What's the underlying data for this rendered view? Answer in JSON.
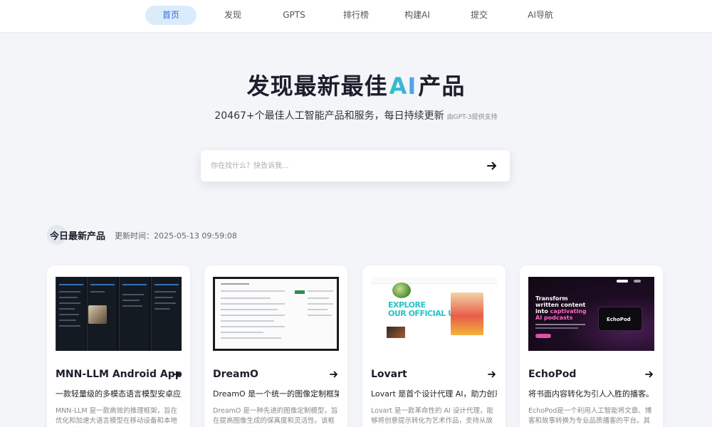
{
  "nav": {
    "items": [
      {
        "label": "首页",
        "active": true
      },
      {
        "label": "发现",
        "active": false
      },
      {
        "label": "GPTS",
        "active": false
      },
      {
        "label": "排行榜",
        "active": false
      },
      {
        "label": "构建AI",
        "active": false
      },
      {
        "label": "提交",
        "active": false
      },
      {
        "label": "AI导航",
        "active": false
      }
    ]
  },
  "hero": {
    "title_prefix": "发现最新最佳",
    "title_ai": "AI",
    "title_suffix": "产品",
    "subtitle": "20467+个最佳人工智能产品和服务，每日持续更新",
    "subtitle_note": "由GPT-3提供支持"
  },
  "search": {
    "placeholder": "你在找什么？快告诉我..."
  },
  "section": {
    "title": "今日最新产品",
    "updated": "更新时间：2025-05-13 09:59:08"
  },
  "products": [
    {
      "name": "MNN-LLM Android App",
      "tagline": "一款轻量级的多模态语言模型安卓应用",
      "desc": "MNN-LLM 是一款高效的推理框架，旨在优化和加速大语言模型在移动设备和本地 PC 上的部署"
    },
    {
      "name": "DreamO",
      "tagline": "DreamO 是一个统一的图像定制框架。",
      "desc": "DreamO 是一种先进的图像定制模型，旨在提高图像生成的保真度和灵活性。该框架结合了多种条件"
    },
    {
      "name": "Lovart",
      "tagline": "Lovart 是首个设计代理 AI，助力创意实现",
      "desc": "Lovart 是一款革命性的 AI 设计代理，能够将创意提示转化为艺术作品，支持从故事板到品牌视觉"
    },
    {
      "name": "EchoPod",
      "tagline": "将书面内容转化为引人入胜的播客。",
      "desc": "EchoPod是一个利用人工智能将文章、博客和故事转换为专业品质播客的平台。其重要性在于"
    }
  ],
  "thumb_text": {
    "lovart_headline_1": "EXPLORE",
    "lovart_headline_2": "OUR OFFICIAL USE",
    "echopod_line1": "Transform written content into",
    "echopod_line2": "captivating AI podcasts",
    "echopod_logo": "EchoPod"
  },
  "colors": {
    "accent": "#2f6fdb",
    "active_nav_bg": "#dcebfb",
    "page_bg": "#f3f5f8"
  }
}
